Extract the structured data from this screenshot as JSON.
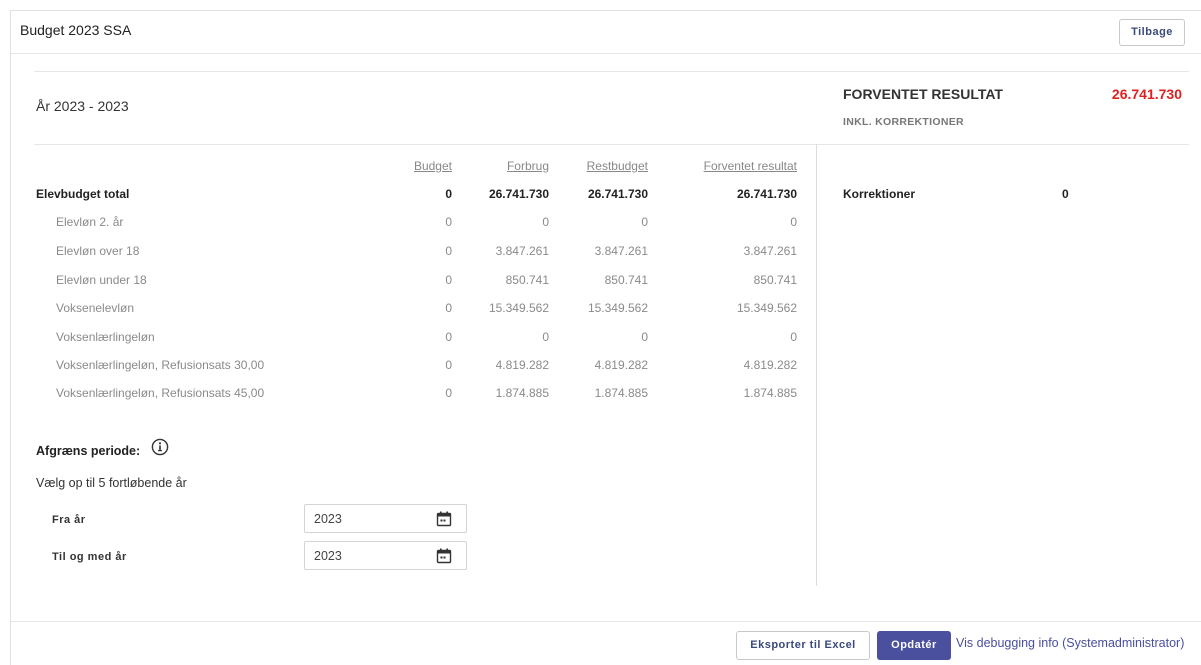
{
  "header": {
    "title": "Budget 2023 SSA",
    "back_label": "Tilbage"
  },
  "year_heading": "År 2023 - 2023",
  "result": {
    "label": "FORVENTET RESULTAT",
    "value": "26.741.730",
    "sublabel": "INKL. KORREKTIONER",
    "value_color": "#e02020"
  },
  "table": {
    "columns": [
      "Budget",
      "Forbrug",
      "Restbudget",
      "Forventet resultat"
    ],
    "rows": [
      {
        "label": "Elevbudget total",
        "values": [
          "0",
          "26.741.730",
          "26.741.730",
          "26.741.730"
        ]
      },
      {
        "label": "Elevløn 2. år",
        "values": [
          "0",
          "0",
          "0",
          "0"
        ]
      },
      {
        "label": "Elevløn over 18",
        "values": [
          "0",
          "3.847.261",
          "3.847.261",
          "3.847.261"
        ]
      },
      {
        "label": "Elevløn under 18",
        "values": [
          "0",
          "850.741",
          "850.741",
          "850.741"
        ]
      },
      {
        "label": "Voksenelevløn",
        "values": [
          "0",
          "15.349.562",
          "15.349.562",
          "15.349.562"
        ]
      },
      {
        "label": "Voksenlærlingeløn",
        "values": [
          "0",
          "0",
          "0",
          "0"
        ]
      },
      {
        "label": "Voksenlærlingeløn, Refusionsats 30,00",
        "values": [
          "0",
          "4.819.282",
          "4.819.282",
          "4.819.282"
        ]
      },
      {
        "label": "Voksenlærlingeløn, Refusionsats 45,00",
        "values": [
          "0",
          "1.874.885",
          "1.874.885",
          "1.874.885"
        ]
      }
    ]
  },
  "corrections": {
    "label": "Korrektioner",
    "value": "0"
  },
  "period": {
    "label": "Afgræns periode:",
    "help": "Vælg op til 5 fortløbende år",
    "info_icon": "info-icon",
    "from_label": "Fra år",
    "from_value": "2023",
    "to_label": "Til og med år",
    "to_value": "2023",
    "calendar_icon": "calendar-icon"
  },
  "footer": {
    "export_label": "Eksporter til Excel",
    "update_label": "Opdatér",
    "debug_label": "Vis debugging info (Systemadministrator)",
    "accent_color": "#4a4f9e"
  }
}
